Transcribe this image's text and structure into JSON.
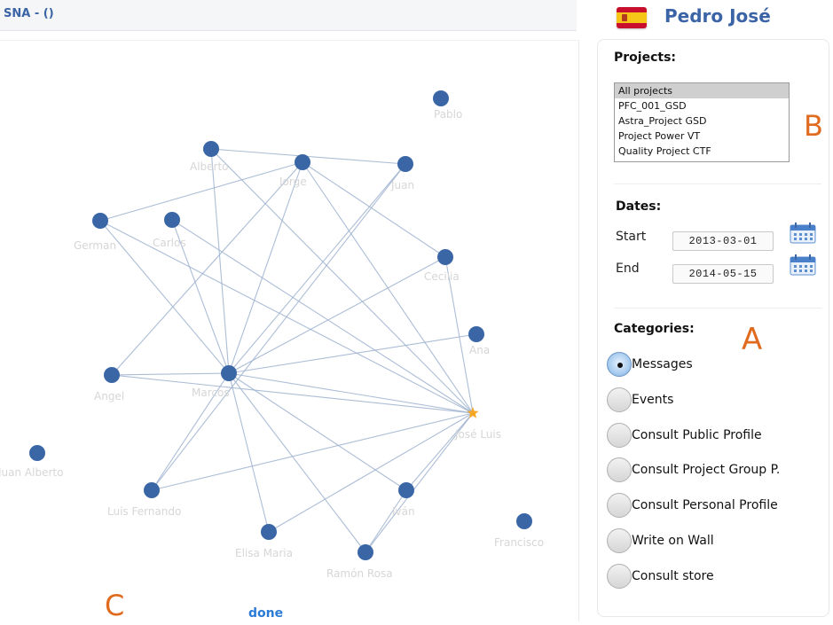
{
  "header": {
    "title": "SNA - ()"
  },
  "user": {
    "name": "Pedro José",
    "flag_icon": "spain-flag-icon"
  },
  "projects": {
    "title": "Projects:",
    "items": [
      "All projects",
      "PFC_001_GSD",
      "Astra_Project GSD",
      "Project Power VT",
      "Quality Project CTF"
    ],
    "selected": "All projects"
  },
  "dates": {
    "title": "Dates:",
    "start_label": "Start",
    "start_value": "2013-03-01",
    "end_label": "End",
    "end_value": "2014-05-15"
  },
  "categories": {
    "title": "Categories:",
    "options": [
      "Messages",
      "Events",
      "Consult Public Profile",
      "Consult Project Group P.",
      "Consult Personal Profile",
      "Write on Wall",
      "Consult store"
    ],
    "selected": "Messages"
  },
  "annotations": {
    "a": "A",
    "b": "B",
    "c": "C"
  },
  "graph": {
    "done_label": "done",
    "node_color": "#3a66a6",
    "edge_color": "#9eb2cf",
    "center_color": "#f5a623",
    "nodes": [
      {
        "id": "n_pablo",
        "label": "Pablo"
      },
      {
        "id": "n_alberto",
        "label": "Alberto"
      },
      {
        "id": "n_jorge",
        "label": "Jorge"
      },
      {
        "id": "n_juan",
        "label": "Juan"
      },
      {
        "id": "n_german",
        "label": "German"
      },
      {
        "id": "n_carlos",
        "label": "Carlos"
      },
      {
        "id": "n_cecilia",
        "label": "Cecilia"
      },
      {
        "id": "n_ana",
        "label": "Ana"
      },
      {
        "id": "n_angel",
        "label": "Angel"
      },
      {
        "id": "n_marcos",
        "label": "Marcos"
      },
      {
        "id": "n_joseluis",
        "label": "José Luis"
      },
      {
        "id": "n_juanalberto",
        "label": "Juan Alberto"
      },
      {
        "id": "n_luisfernando",
        "label": "Luis Fernando"
      },
      {
        "id": "n_ivan",
        "label": "Iván"
      },
      {
        "id": "n_francisco",
        "label": "Francisco"
      },
      {
        "id": "n_elisa",
        "label": "Elisa Maria"
      },
      {
        "id": "n_ramon",
        "label": "Ramón Rosa"
      }
    ],
    "center_node": "n_joseluis",
    "edges": [
      [
        "n_german",
        "n_jorge"
      ],
      [
        "n_german",
        "n_marcos"
      ],
      [
        "n_german",
        "n_joseluis"
      ],
      [
        "n_carlos",
        "n_marcos"
      ],
      [
        "n_carlos",
        "n_joseluis"
      ],
      [
        "n_alberto",
        "n_marcos"
      ],
      [
        "n_alberto",
        "n_joseluis"
      ],
      [
        "n_alberto",
        "n_juan"
      ],
      [
        "n_jorge",
        "n_marcos"
      ],
      [
        "n_jorge",
        "n_joseluis"
      ],
      [
        "n_jorge",
        "n_cecilia"
      ],
      [
        "n_jorge",
        "n_angel"
      ],
      [
        "n_juan",
        "n_marcos"
      ],
      [
        "n_juan",
        "n_luisfernando"
      ],
      [
        "n_cecilia",
        "n_marcos"
      ],
      [
        "n_cecilia",
        "n_joseluis"
      ],
      [
        "n_ana",
        "n_marcos"
      ],
      [
        "n_angel",
        "n_joseluis"
      ],
      [
        "n_angel",
        "n_marcos"
      ],
      [
        "n_marcos",
        "n_joseluis"
      ],
      [
        "n_marcos",
        "n_luisfernando"
      ],
      [
        "n_marcos",
        "n_elisa"
      ],
      [
        "n_marcos",
        "n_ramon"
      ],
      [
        "n_marcos",
        "n_ivan"
      ],
      [
        "n_joseluis",
        "n_luisfernando"
      ],
      [
        "n_joseluis",
        "n_elisa"
      ],
      [
        "n_joseluis",
        "n_ramon"
      ],
      [
        "n_joseluis",
        "n_ivan"
      ],
      [
        "n_ivan",
        "n_ramon"
      ]
    ]
  }
}
